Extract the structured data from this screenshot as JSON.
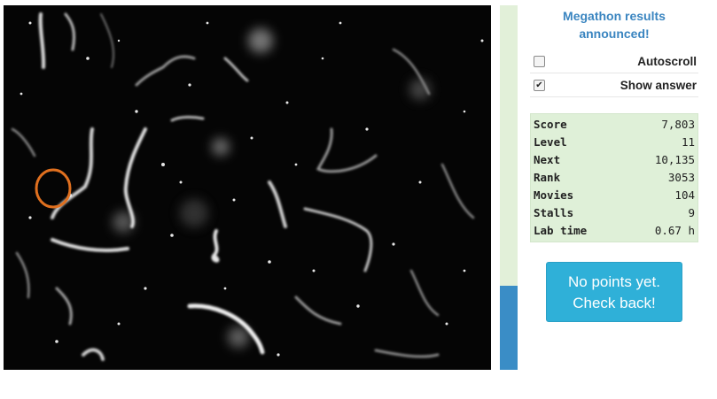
{
  "viewer": {
    "progress_fraction": 0.23
  },
  "panel": {
    "announcement": "Megathon results\nannounced!",
    "options": [
      {
        "label": "Autoscroll",
        "checked": false
      },
      {
        "label": "Show answer",
        "checked": true
      }
    ],
    "stats": [
      {
        "label": "Score",
        "value": "7,803"
      },
      {
        "label": "Level",
        "value": "11"
      },
      {
        "label": "Next",
        "value": "10,135"
      },
      {
        "label": "Rank",
        "value": "3053"
      },
      {
        "label": "Movies",
        "value": "104"
      },
      {
        "label": "Stalls",
        "value": "9"
      },
      {
        "label": "Lab time",
        "value": "0.67 h"
      }
    ],
    "points_button": "No points yet.\nCheck back!"
  },
  "colors": {
    "marker": "#e0701f",
    "progress_fill": "#3a8dc6",
    "progress_track": "#e2f0d9",
    "stats_bg": "#dff0d8",
    "button_bg": "#2fb0d8",
    "link": "#3a85c0"
  }
}
